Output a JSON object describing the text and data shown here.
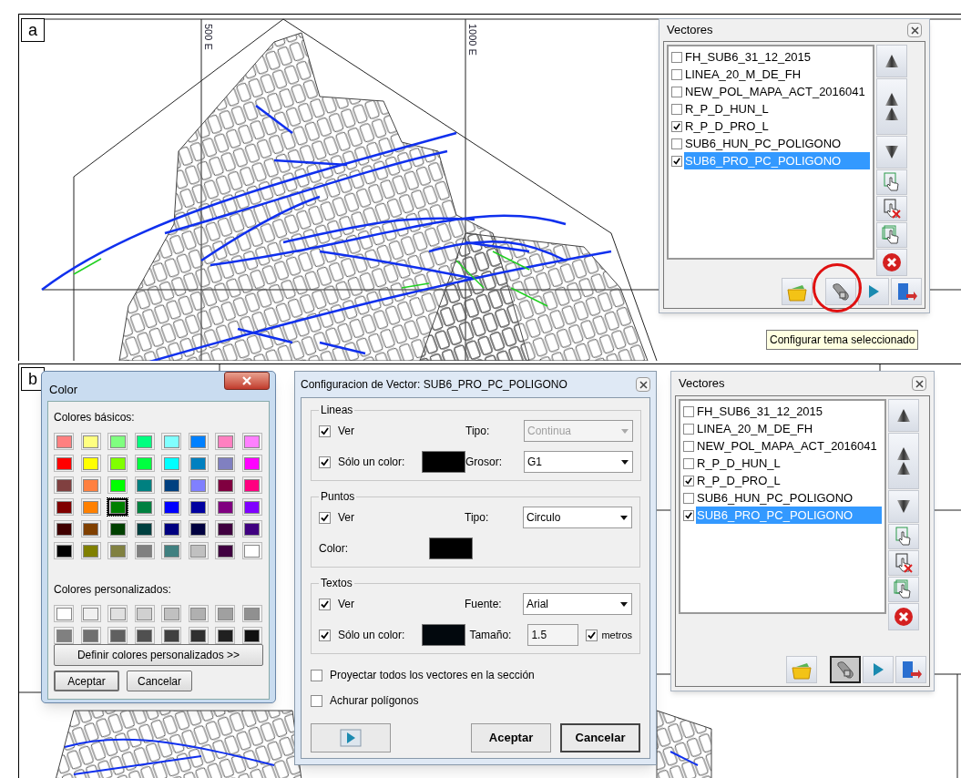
{
  "panel_a": {
    "label": "a",
    "map": {
      "axis_labels": [
        "500 E",
        "1000 E"
      ]
    },
    "vectores": {
      "title": "Vectores",
      "config_button": {
        "circled": true,
        "pressed": false
      },
      "layers": [
        {
          "name": "FH_SUB6_31_12_2015",
          "checked": false,
          "selected": false
        },
        {
          "name": "LINEA_20_M_DE_FH",
          "checked": false,
          "selected": false
        },
        {
          "name": "NEW_POL_MAPA_ACT_2016041",
          "checked": false,
          "selected": false
        },
        {
          "name": "R_P_D_HUN_L",
          "checked": false,
          "selected": false
        },
        {
          "name": "R_P_D_PRO_L",
          "checked": true,
          "selected": false
        },
        {
          "name": "SUB6_HUN_PC_POLIGONO",
          "checked": false,
          "selected": false
        },
        {
          "name": "SUB6_PRO_PC_POLIGONO",
          "checked": true,
          "selected": true
        }
      ]
    },
    "tooltip": "Configurar tema seleccionado"
  },
  "panel_b": {
    "label": "b",
    "color_dialog": {
      "title": "Color",
      "basic_label": "Colores básicos:",
      "basic_colors": [
        {
          "color": "#ff8080",
          "selected": false
        },
        {
          "color": "#ffff80",
          "selected": false
        },
        {
          "color": "#80ff80",
          "selected": false
        },
        {
          "color": "#00ff80",
          "selected": false
        },
        {
          "color": "#80ffff",
          "selected": false
        },
        {
          "color": "#0080ff",
          "selected": false
        },
        {
          "color": "#ff80c0",
          "selected": false
        },
        {
          "color": "#ff80ff",
          "selected": false
        },
        {
          "color": "#ff0000",
          "selected": false
        },
        {
          "color": "#ffff00",
          "selected": false
        },
        {
          "color": "#80ff00",
          "selected": false
        },
        {
          "color": "#00ff40",
          "selected": false
        },
        {
          "color": "#00ffff",
          "selected": false
        },
        {
          "color": "#0080c0",
          "selected": false
        },
        {
          "color": "#8080c0",
          "selected": false
        },
        {
          "color": "#ff00ff",
          "selected": false
        },
        {
          "color": "#804040",
          "selected": false
        },
        {
          "color": "#ff8040",
          "selected": false
        },
        {
          "color": "#00ff00",
          "selected": false
        },
        {
          "color": "#008080",
          "selected": false
        },
        {
          "color": "#004080",
          "selected": false
        },
        {
          "color": "#8080ff",
          "selected": false
        },
        {
          "color": "#800040",
          "selected": false
        },
        {
          "color": "#ff0080",
          "selected": false
        },
        {
          "color": "#800000",
          "selected": false
        },
        {
          "color": "#ff8000",
          "selected": false
        },
        {
          "color": "#008000",
          "selected": true
        },
        {
          "color": "#008040",
          "selected": false
        },
        {
          "color": "#0000ff",
          "selected": false
        },
        {
          "color": "#0000a0",
          "selected": false
        },
        {
          "color": "#800080",
          "selected": false
        },
        {
          "color": "#8000ff",
          "selected": false
        },
        {
          "color": "#400000",
          "selected": false
        },
        {
          "color": "#804000",
          "selected": false
        },
        {
          "color": "#004000",
          "selected": false
        },
        {
          "color": "#004040",
          "selected": false
        },
        {
          "color": "#000080",
          "selected": false
        },
        {
          "color": "#000040",
          "selected": false
        },
        {
          "color": "#400040",
          "selected": false
        },
        {
          "color": "#400080",
          "selected": false
        },
        {
          "color": "#000000",
          "selected": false
        },
        {
          "color": "#808000",
          "selected": false
        },
        {
          "color": "#808040",
          "selected": false
        },
        {
          "color": "#808080",
          "selected": false
        },
        {
          "color": "#408080",
          "selected": false
        },
        {
          "color": "#c0c0c0",
          "selected": false
        },
        {
          "color": "#400040",
          "selected": false
        },
        {
          "color": "#ffffff",
          "selected": false
        }
      ],
      "custom_label": "Colores personalizados:",
      "custom_colors": [
        {
          "color": "#ffffff",
          "selected": false
        },
        {
          "color": "#f0f0f0",
          "selected": false
        },
        {
          "color": "#e0e0e0",
          "selected": false
        },
        {
          "color": "#d0d0d0",
          "selected": false
        },
        {
          "color": "#c0c0c0",
          "selected": false
        },
        {
          "color": "#b0b0b0",
          "selected": false
        },
        {
          "color": "#a0a0a0",
          "selected": false
        },
        {
          "color": "#909090",
          "selected": false
        },
        {
          "color": "#808080",
          "selected": false
        },
        {
          "color": "#707070",
          "selected": false
        },
        {
          "color": "#606060",
          "selected": false
        },
        {
          "color": "#505050",
          "selected": false
        },
        {
          "color": "#404040",
          "selected": false
        },
        {
          "color": "#303030",
          "selected": false
        },
        {
          "color": "#202020",
          "selected": false
        },
        {
          "color": "#101010",
          "selected": false
        }
      ],
      "define_button": "Definir colores personalizados >>",
      "buttons": [
        "Aceptar",
        "Cancelar"
      ]
    },
    "config_dialog": {
      "title": "Configuracion de Vector: SUB6_PRO_PC_POLIGONO",
      "groups": [
        {
          "title": "Lineas",
          "rows": [
            {
              "left": {
                "kind": "check",
                "label": "Ver",
                "checked": true
              },
              "right": {
                "kind": "select",
                "label": "Tipo:",
                "value": "Continua",
                "disabled": true
              }
            },
            {
              "left": {
                "kind": "check_color",
                "label": "Sólo un color:",
                "checked": true,
                "color": "#000000"
              },
              "right": {
                "kind": "select",
                "label": "Grosor:",
                "value": "G1",
                "disabled": false
              }
            }
          ]
        },
        {
          "title": "Puntos",
          "rows": [
            {
              "left": {
                "kind": "check",
                "label": "Ver",
                "checked": true
              },
              "right": {
                "kind": "select",
                "label": "Tipo:",
                "value": "Circulo",
                "disabled": false
              }
            },
            {
              "left": {
                "kind": "color",
                "label": "Color:",
                "color": "#000000"
              }
            }
          ]
        },
        {
          "title": "Textos",
          "rows": [
            {
              "left": {
                "kind": "check",
                "label": "Ver",
                "checked": true
              },
              "right": {
                "kind": "select",
                "label": "Fuente:",
                "value": "Arial",
                "disabled": false
              }
            },
            {
              "left": {
                "kind": "check_color",
                "label": "Sólo un color:",
                "checked": true,
                "color": "#02080d"
              },
              "right": {
                "kind": "size",
                "label": "Tamaño:",
                "value": "1.5",
                "unit": "metros",
                "checked": true
              }
            }
          ]
        }
      ],
      "options": [
        {
          "label": "Proyectar todos los vectores en la sección",
          "checked": false
        },
        {
          "label": "Achurar polígonos",
          "checked": false
        }
      ],
      "buttons": [
        "Aceptar",
        "Cancelar"
      ]
    },
    "vectores": {
      "title": "Vectores",
      "config_button": {
        "circled": false,
        "pressed": true
      },
      "layers": [
        {
          "name": "FH_SUB6_31_12_2015",
          "checked": false,
          "selected": false
        },
        {
          "name": "LINEA_20_M_DE_FH",
          "checked": false,
          "selected": false
        },
        {
          "name": "NEW_POL_MAPA_ACT_2016041",
          "checked": false,
          "selected": false
        },
        {
          "name": "R_P_D_HUN_L",
          "checked": false,
          "selected": false
        },
        {
          "name": "R_P_D_PRO_L",
          "checked": true,
          "selected": false
        },
        {
          "name": "SUB6_HUN_PC_POLIGONO",
          "checked": false,
          "selected": false
        },
        {
          "name": "SUB6_PRO_PC_POLIGONO",
          "checked": true,
          "selected": true
        }
      ]
    }
  }
}
